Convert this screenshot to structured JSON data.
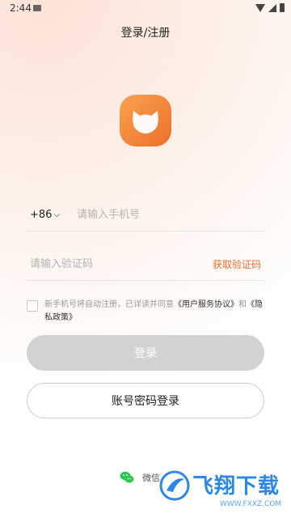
{
  "status": {
    "time": "2:44"
  },
  "page": {
    "title": "登录/注册"
  },
  "phone": {
    "country_code": "+86",
    "placeholder": "请输入手机号"
  },
  "code": {
    "placeholder": "请输入验证码",
    "get_code_label": "获取验证码"
  },
  "agreement": {
    "prefix": "新手机号将自动注册，已详读并同意",
    "user_agreement": "《用户服务协议》",
    "and": "和",
    "privacy": "《隐私政策》"
  },
  "buttons": {
    "login": "登录",
    "password_login": "账号密码登录"
  },
  "third_party": {
    "wechat_label": "微信"
  },
  "watermark": {
    "brand": "飞翔下载",
    "url": "WWW.FXXZ.COM"
  },
  "colors": {
    "accent": "#ee6c2a",
    "login_disabled": "#d2d2d2",
    "wechat": "#2bc84f"
  }
}
